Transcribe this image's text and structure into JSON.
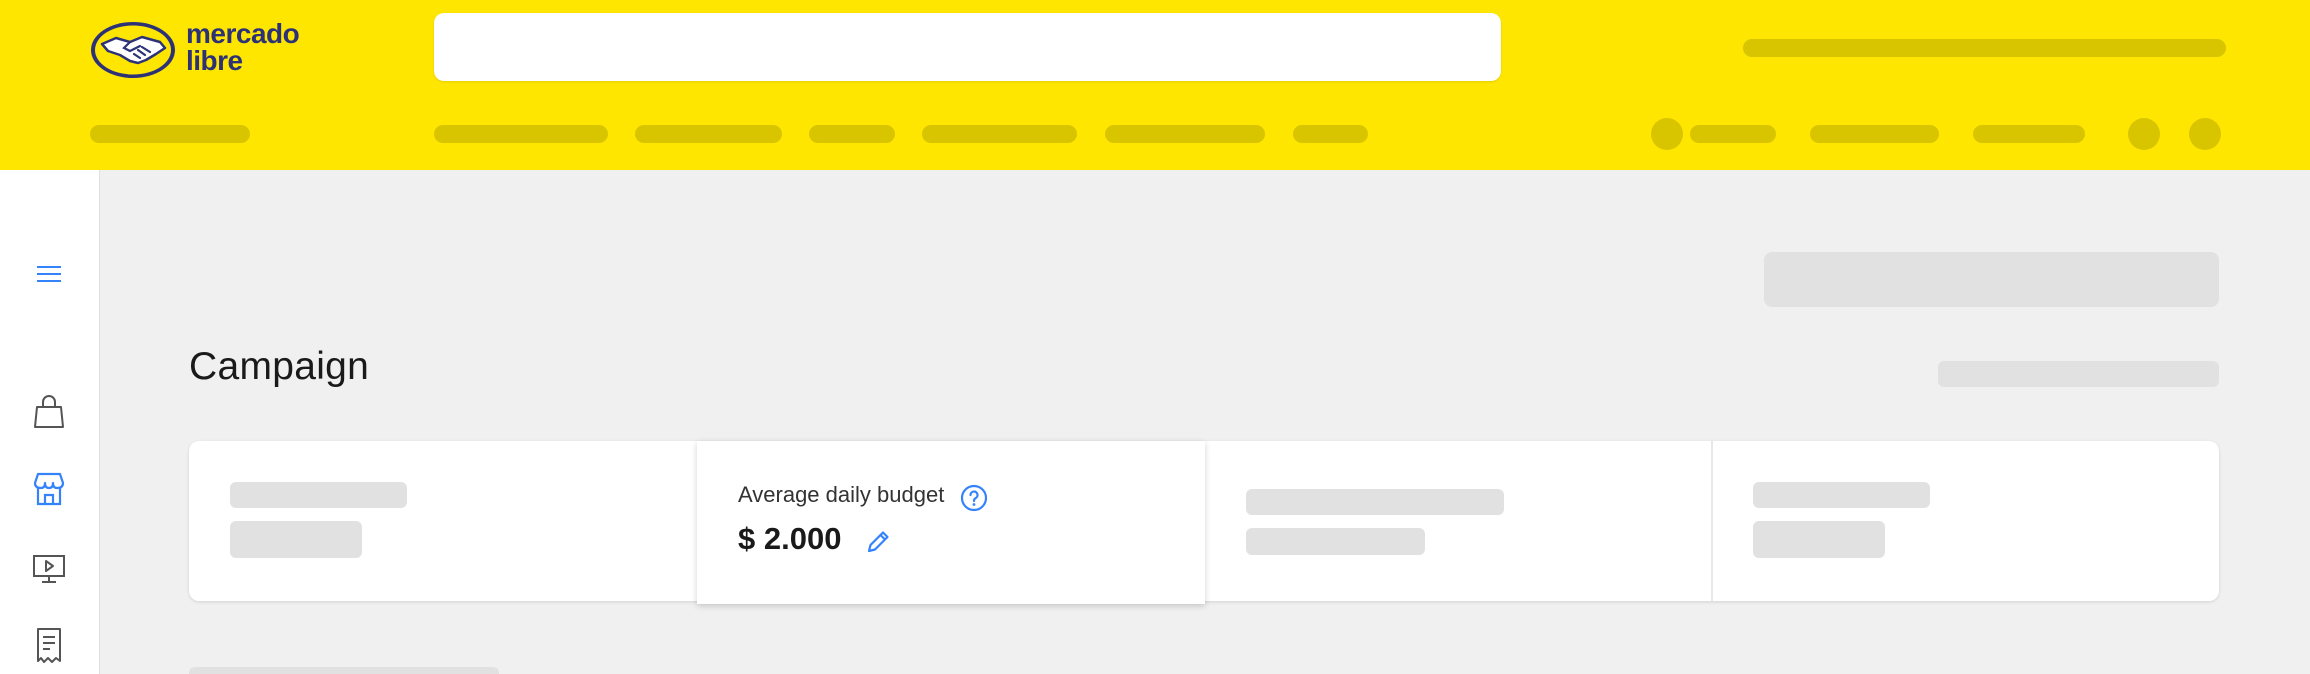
{
  "header": {
    "logo_text_line1": "mercado",
    "logo_text_line2": "libre"
  },
  "sidebar": {
    "items": [
      {
        "name": "menu-icon",
        "active": true
      },
      {
        "name": "shopping-bag-icon",
        "active": false
      },
      {
        "name": "store-icon",
        "active": true
      },
      {
        "name": "video-icon",
        "active": false
      },
      {
        "name": "receipt-icon",
        "active": false
      }
    ]
  },
  "main": {
    "title": "Campaign",
    "metrics": [
      {
        "label": "Average daily budget",
        "value": "$ 2.000",
        "help_icon": "question-icon",
        "edit_icon": "pencil-icon"
      }
    ]
  },
  "colors": {
    "brand_yellow": "#ffe600",
    "brand_blue": "#2d3277",
    "accent_blue": "#3483fa"
  }
}
